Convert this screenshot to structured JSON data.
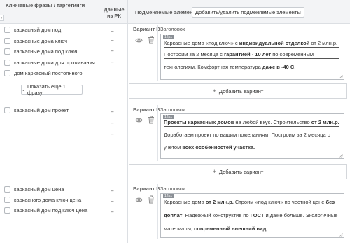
{
  "header": {
    "keywords_title": "Ключевые фразы / таргетинги",
    "data_title_line1": "Данные",
    "data_title_line2": "из РК",
    "substitute_title": "Подменяемые элементы",
    "add_remove_button": "Добавить/удалить подменяемые элементы"
  },
  "groups": [
    {
      "keywords": [
        "каркасный дом под",
        "каркасные дома ключ",
        "каркасные дома под ключ",
        "каркасные дома для проживания",
        "дом каркасный постоянного"
      ],
      "dash": "–",
      "show_more": "Показать ещё 1 фразу",
      "variant_label": "Вариант B",
      "field_label": "Заголовок",
      "badge": "12px",
      "add_variant": "Добавить вариант",
      "ad_segments": [
        [
          [
            "Каркасные дома «под ключ» с ",
            false
          ],
          [
            "индивидуальной отделкой",
            true
          ],
          [
            " от 2 млн.р.",
            false
          ]
        ],
        [
          [
            "Построим за 2 месяца с ",
            false
          ],
          [
            "гарантией - 10 лет",
            true
          ],
          [
            " по современным",
            false
          ]
        ],
        [
          [
            "технологиям. Комфортная температура ",
            false
          ],
          [
            "даже в -40 С",
            true
          ],
          [
            ".",
            false
          ]
        ]
      ]
    },
    {
      "keywords": [
        "каркасный дом проект"
      ],
      "dash": "–",
      "variant_label": "Вариант B",
      "field_label": "Заголовок",
      "badge": "12px",
      "add_variant": "Добавить вариант",
      "ad_segments": [
        [
          [
            "Проекты каркасных домов",
            true
          ],
          [
            " на любой вкус. Строительство ",
            false
          ],
          [
            "от 2 млн.р.",
            true
          ]
        ],
        [
          [
            "Доработаем проект по вашим пожеланиям. Построим за 2 месяца с",
            false
          ]
        ],
        [
          [
            "учетом ",
            false
          ],
          [
            "всех особенностей участка.",
            true
          ]
        ]
      ]
    },
    {
      "keywords": [
        "каркасный дом цена",
        "каркасного дома ключ цена",
        "каркасный дом под ключ цена"
      ],
      "dash": "–",
      "variant_label": "Вариант B",
      "field_label": "Заголовок",
      "badge": "12px",
      "ad_segments": [
        [
          [
            "Каркасные дома ",
            false
          ],
          [
            "от 2 млн.р.",
            true
          ],
          [
            " Строим «под ключ» по честной цене ",
            false
          ],
          [
            "без",
            true
          ]
        ],
        [
          [
            "доплат",
            true
          ],
          [
            ". Надежный конструктив по ",
            false
          ],
          [
            "ГОСТ",
            true
          ],
          [
            " и даже больше. Экологичные",
            false
          ]
        ],
        [
          [
            "материалы, ",
            false
          ],
          [
            "современный внешний вид",
            true
          ],
          [
            ".",
            false
          ]
        ]
      ]
    }
  ],
  "icons": {
    "eye": "eye-icon",
    "trash": "trash-icon",
    "plus": "plus-icon",
    "chevron": "chevron-down-icon"
  }
}
